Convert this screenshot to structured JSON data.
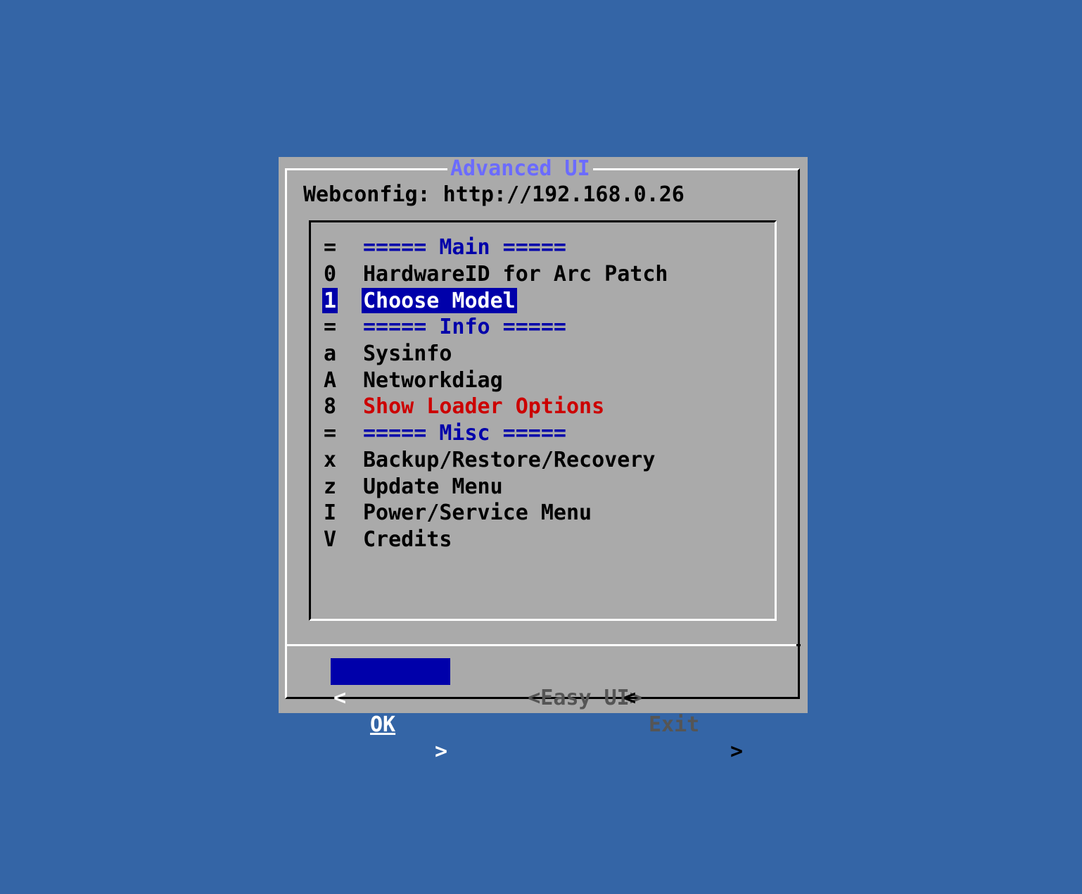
{
  "dialog": {
    "title": "Advanced UI",
    "webconfig": "Webconfig: http://192.168.0.26"
  },
  "menu": [
    {
      "key": "=",
      "label": "===== Main =====",
      "kind": "separator"
    },
    {
      "key": "0",
      "label": "HardwareID for Arc Patch",
      "kind": "item"
    },
    {
      "key": "1",
      "label": "Choose Model",
      "kind": "item",
      "selected": true
    },
    {
      "key": "=",
      "label": "===== Info =====",
      "kind": "separator"
    },
    {
      "key": "a",
      "label": "Sysinfo",
      "kind": "item"
    },
    {
      "key": "A",
      "label": "Networkdiag",
      "kind": "item"
    },
    {
      "key": "8",
      "label": "Show Loader Options",
      "kind": "item",
      "color": "red"
    },
    {
      "key": "=",
      "label": "===== Misc =====",
      "kind": "separator"
    },
    {
      "key": "x",
      "label": "Backup/Restore/Recovery",
      "kind": "item"
    },
    {
      "key": "z",
      "label": "Update Menu",
      "kind": "item"
    },
    {
      "key": "I",
      "label": "Power/Service Menu",
      "kind": "item"
    },
    {
      "key": "V",
      "label": "Credits",
      "kind": "item"
    }
  ],
  "buttons": {
    "ok": {
      "left": "<",
      "label": "OK",
      "right": ">"
    },
    "easy": {
      "label": "<Easy UI>"
    },
    "exit": {
      "left": "<",
      "label": "Exit",
      "right": ">"
    }
  },
  "colors": {
    "background": "#3465a6",
    "dialog": "#aaaaaa",
    "selection": "#0000aa",
    "separator_text": "#0000aa",
    "warning_text": "#cc0000",
    "title_text": "#6b6bff"
  }
}
